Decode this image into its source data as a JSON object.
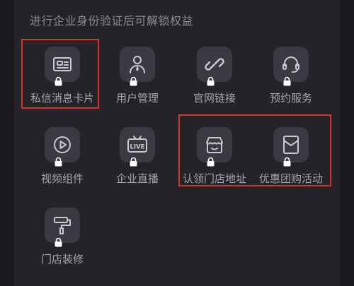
{
  "header": {
    "title": "进行企业身份验证后可解锁权益"
  },
  "features": [
    {
      "label": "私信消息卡片",
      "icon": "message-card-icon"
    },
    {
      "label": "用户管理",
      "icon": "user-manage-icon"
    },
    {
      "label": "官网链接",
      "icon": "link-icon"
    },
    {
      "label": "预约服务",
      "icon": "headset-icon"
    },
    {
      "label": "视频组件",
      "icon": "play-icon"
    },
    {
      "label": "企业直播",
      "icon": "live-tv-icon"
    },
    {
      "label": "认领门店地址",
      "icon": "store-icon"
    },
    {
      "label": "优惠团购活动",
      "icon": "coupon-envelope-icon"
    },
    {
      "label": "门店装修",
      "icon": "paint-roller-icon"
    }
  ],
  "colors": {
    "background": "#1b1b1f",
    "panel": "#232329",
    "tile": "#3a3a42",
    "icon": "#c9c9cf",
    "text": "#a5a5ac",
    "highlight": "#d8322c"
  }
}
